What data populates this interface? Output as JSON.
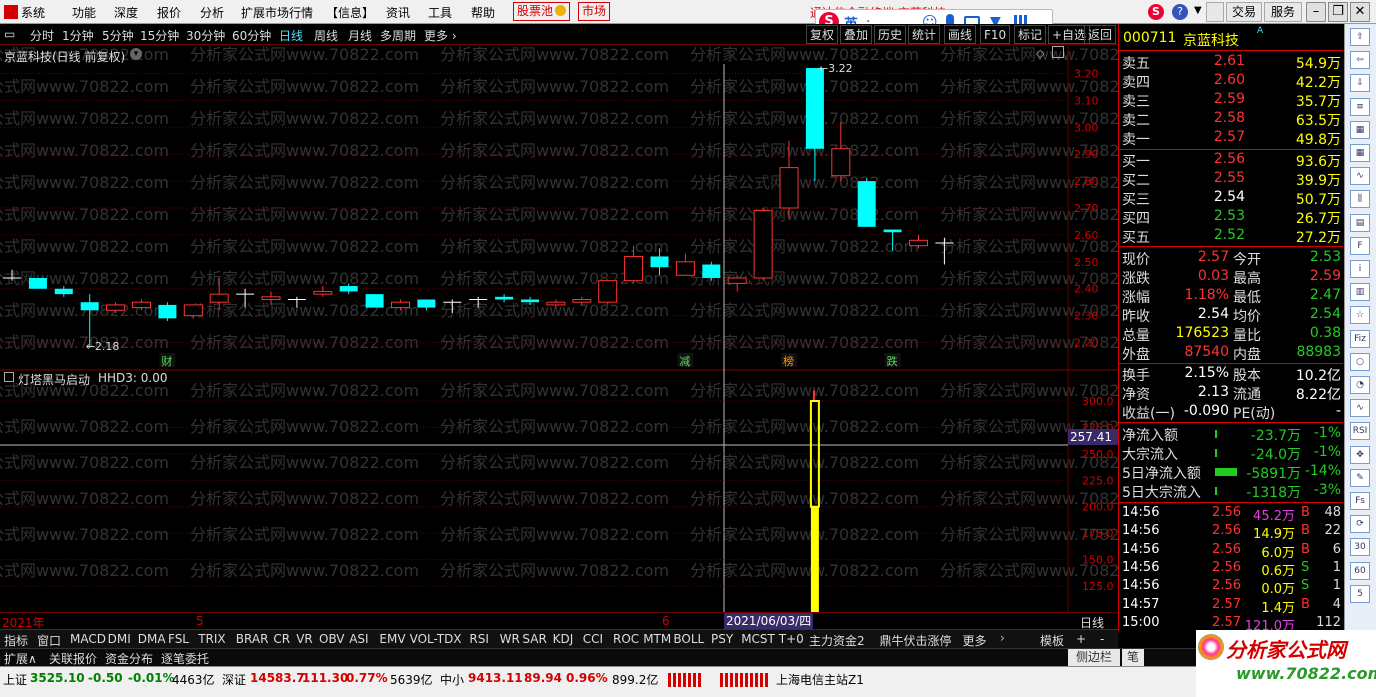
{
  "menu": {
    "items": [
      "系统",
      "功能",
      "深度",
      "报价",
      "分析",
      "扩展市场行情",
      "【信息】",
      "资讯",
      "工具",
      "帮助"
    ],
    "stock_pool": "股票池",
    "market": "市场",
    "window_title": "通达信金融终端 京蓝科技",
    "trade": "交易",
    "service": "服务"
  },
  "ime": {
    "lang": "英"
  },
  "toolbar": {
    "periods": [
      "分时",
      "1分钟",
      "5分钟",
      "15分钟",
      "30分钟",
      "60分钟",
      "日线",
      "周线",
      "月线",
      "多周期",
      "更多"
    ],
    "active": "日线",
    "right": [
      "复权",
      "叠加",
      "历史",
      "统计",
      "画线",
      "F10",
      "标记",
      "+自选",
      "返回"
    ]
  },
  "chart": {
    "title": "京蓝科技(日线 前复权)",
    "high_label": "3.22",
    "low_label": "2.18",
    "events": [
      "财",
      "减",
      "榜",
      "跌"
    ],
    "y_ticks": [
      "3.20",
      "3.10",
      "3.00",
      "2.90",
      "2.80",
      "2.70",
      "2.60",
      "2.50",
      "2.40",
      "2.30",
      "2.20"
    ],
    "sub_title": "灯塔黑马启动",
    "sub_value": "HHD3: 0.00",
    "sub_y_ticks": [
      "300.0",
      "275.0",
      "250.0",
      "225.0",
      "200.0",
      "175.0",
      "150.0",
      "125.0"
    ],
    "crosshair_value": "257.41",
    "dates": [
      "2021年",
      "5",
      "6"
    ],
    "crosshair_date": "2021/06/03/四",
    "period_label": "日线"
  },
  "chart_data": {
    "type": "candlestick",
    "candles": [
      {
        "o": 2.44,
        "h": 2.47,
        "l": 2.43,
        "c": 2.44
      },
      {
        "o": 2.44,
        "h": 2.44,
        "l": 2.4,
        "c": 2.4
      },
      {
        "o": 2.4,
        "h": 2.41,
        "l": 2.37,
        "c": 2.38
      },
      {
        "o": 2.35,
        "h": 2.38,
        "l": 2.18,
        "c": 2.32
      },
      {
        "o": 2.32,
        "h": 2.35,
        "l": 2.31,
        "c": 2.34
      },
      {
        "o": 2.33,
        "h": 2.36,
        "l": 2.32,
        "c": 2.35
      },
      {
        "o": 2.34,
        "h": 2.35,
        "l": 2.28,
        "c": 2.29
      },
      {
        "o": 2.3,
        "h": 2.34,
        "l": 2.29,
        "c": 2.34
      },
      {
        "o": 2.35,
        "h": 2.44,
        "l": 2.32,
        "c": 2.38
      },
      {
        "o": 2.38,
        "h": 2.4,
        "l": 2.33,
        "c": 2.38
      },
      {
        "o": 2.36,
        "h": 2.39,
        "l": 2.34,
        "c": 2.37
      },
      {
        "o": 2.36,
        "h": 2.37,
        "l": 2.33,
        "c": 2.36
      },
      {
        "o": 2.38,
        "h": 2.41,
        "l": 2.37,
        "c": 2.39
      },
      {
        "o": 2.41,
        "h": 2.42,
        "l": 2.38,
        "c": 2.39
      },
      {
        "o": 2.38,
        "h": 2.38,
        "l": 2.33,
        "c": 2.33
      },
      {
        "o": 2.33,
        "h": 2.36,
        "l": 2.32,
        "c": 2.35
      },
      {
        "o": 2.36,
        "h": 2.36,
        "l": 2.32,
        "c": 2.33
      },
      {
        "o": 2.35,
        "h": 2.36,
        "l": 2.31,
        "c": 2.35
      },
      {
        "o": 2.36,
        "h": 2.37,
        "l": 2.33,
        "c": 2.36
      },
      {
        "o": 2.37,
        "h": 2.38,
        "l": 2.35,
        "c": 2.36
      },
      {
        "o": 2.36,
        "h": 2.37,
        "l": 2.34,
        "c": 2.35
      },
      {
        "o": 2.34,
        "h": 2.36,
        "l": 2.33,
        "c": 2.35
      },
      {
        "o": 2.35,
        "h": 2.37,
        "l": 2.34,
        "c": 2.36
      },
      {
        "o": 2.35,
        "h": 2.43,
        "l": 2.34,
        "c": 2.43
      },
      {
        "o": 2.43,
        "h": 2.56,
        "l": 2.42,
        "c": 2.52
      },
      {
        "o": 2.52,
        "h": 2.55,
        "l": 2.45,
        "c": 2.48
      },
      {
        "o": 2.45,
        "h": 2.53,
        "l": 2.45,
        "c": 2.5
      },
      {
        "o": 2.49,
        "h": 2.5,
        "l": 2.43,
        "c": 2.44
      },
      {
        "o": 2.42,
        "h": 2.45,
        "l": 2.39,
        "c": 2.44
      },
      {
        "o": 2.44,
        "h": 2.7,
        "l": 2.43,
        "c": 2.69
      },
      {
        "o": 2.7,
        "h": 2.95,
        "l": 2.66,
        "c": 2.85
      },
      {
        "o": 3.22,
        "h": 3.22,
        "l": 2.8,
        "c": 2.92
      },
      {
        "o": 2.82,
        "h": 3.02,
        "l": 2.8,
        "c": 2.92
      },
      {
        "o": 2.8,
        "h": 2.81,
        "l": 2.63,
        "c": 2.63
      },
      {
        "o": 2.62,
        "h": 2.62,
        "l": 2.54,
        "c": 2.61
      },
      {
        "o": 2.56,
        "h": 2.6,
        "l": 2.55,
        "c": 2.58
      },
      {
        "o": 2.57,
        "h": 2.59,
        "l": 2.49,
        "c": 2.57
      }
    ],
    "indicator": {
      "name": "HHD3",
      "bars": [
        {
          "index": 31,
          "top": 300.0,
          "bottom": 200.0,
          "yellow_to": 300.0
        }
      ]
    }
  },
  "quote": {
    "code": "000711",
    "name": "京蓝科技",
    "asks": [
      [
        "卖五",
        "2.61",
        "54.9万"
      ],
      [
        "卖四",
        "2.60",
        "42.2万"
      ],
      [
        "卖三",
        "2.59",
        "35.7万"
      ],
      [
        "卖二",
        "2.58",
        "63.5万"
      ],
      [
        "卖一",
        "2.57",
        "49.8万"
      ]
    ],
    "bids": [
      [
        "买一",
        "2.56",
        "93.6万"
      ],
      [
        "买二",
        "2.55",
        "39.9万"
      ],
      [
        "买三",
        "2.54",
        "50.7万"
      ],
      [
        "买四",
        "2.53",
        "26.7万"
      ],
      [
        "买五",
        "2.52",
        "27.2万"
      ]
    ],
    "stats": [
      [
        "现价",
        "2.57",
        "今开",
        "2.53"
      ],
      [
        "涨跌",
        "0.03",
        "最高",
        "2.59"
      ],
      [
        "涨幅",
        "1.18%",
        "最低",
        "2.47"
      ],
      [
        "昨收",
        "2.54",
        "均价",
        "2.54"
      ],
      [
        "总量",
        "176523",
        "量比",
        "0.38"
      ],
      [
        "外盘",
        "87540",
        "内盘",
        "88983"
      ]
    ],
    "fund": [
      [
        "换手",
        "2.15%",
        "股本",
        "10.2亿"
      ],
      [
        "净资",
        "2.13",
        "流通",
        "8.22亿"
      ],
      [
        "收益(一)",
        "-0.090",
        "PE(动)",
        "-"
      ]
    ],
    "flow": [
      [
        "净流入额",
        "-23.7万",
        "-1%"
      ],
      [
        "大宗流入",
        "-24.0万",
        "-1%"
      ],
      [
        "5日净流入额",
        "-5891万",
        "-14%"
      ],
      [
        "5日大宗流入",
        "-1318万",
        "-3%"
      ]
    ],
    "ticks": [
      [
        "14:56",
        "2.56",
        "45.2万",
        "B",
        "48"
      ],
      [
        "14:56",
        "2.56",
        "14.9万",
        "B",
        "22"
      ],
      [
        "14:56",
        "2.56",
        "6.0万",
        "B",
        "6"
      ],
      [
        "14:56",
        "2.56",
        "0.6万",
        "S",
        "1"
      ],
      [
        "14:56",
        "2.56",
        "0.0万",
        "S",
        "1"
      ],
      [
        "14:57",
        "2.57",
        "1.4万",
        "B",
        "4"
      ],
      [
        "15:00",
        "2.57",
        "121.0万",
        "",
        "112"
      ]
    ]
  },
  "indicators": [
    "指标",
    "窗口",
    "MACD",
    "DMI",
    "DMA",
    "FSL",
    "TRIX",
    "BRAR",
    "CR",
    "VR",
    "OBV",
    "ASI",
    "EMV",
    "VOL-TDX",
    "RSI",
    "WR",
    "SAR",
    "KDJ",
    "CCI",
    "ROC",
    "MTM",
    "BOLL",
    "PSY",
    "MCST",
    "T+0",
    "主力资金2",
    "鼎牛伏击涨停",
    "更多"
  ],
  "indicators_right": [
    "模板",
    "+",
    "-"
  ],
  "bottom_tabs": [
    "扩展∧",
    "关联报价",
    "资金分布",
    "逐笔委托"
  ],
  "side_tabs": [
    "侧边栏",
    "笔"
  ],
  "status": {
    "sh_label": "上证",
    "sh_val": "3525.10",
    "sh_chg": "-0.50",
    "sh_pct": "-0.01%",
    "sh_amt": "4463亿",
    "sz_label": "深证",
    "sz_val": "14583.7",
    "sz_chg": "111.30",
    "sz_pct": "0.77%",
    "sz_amt": "5639亿",
    "zx_label": "中小",
    "zx_val": "9413.11",
    "zx_chg": "89.94",
    "zx_pct": "0.96%",
    "zx_amt": "899.2亿",
    "server": "上海电信主站Z1"
  },
  "logo": {
    "text": "分析家公式网",
    "url": "www.70822.com"
  },
  "watermark": "分析家公式网www.70822.com"
}
